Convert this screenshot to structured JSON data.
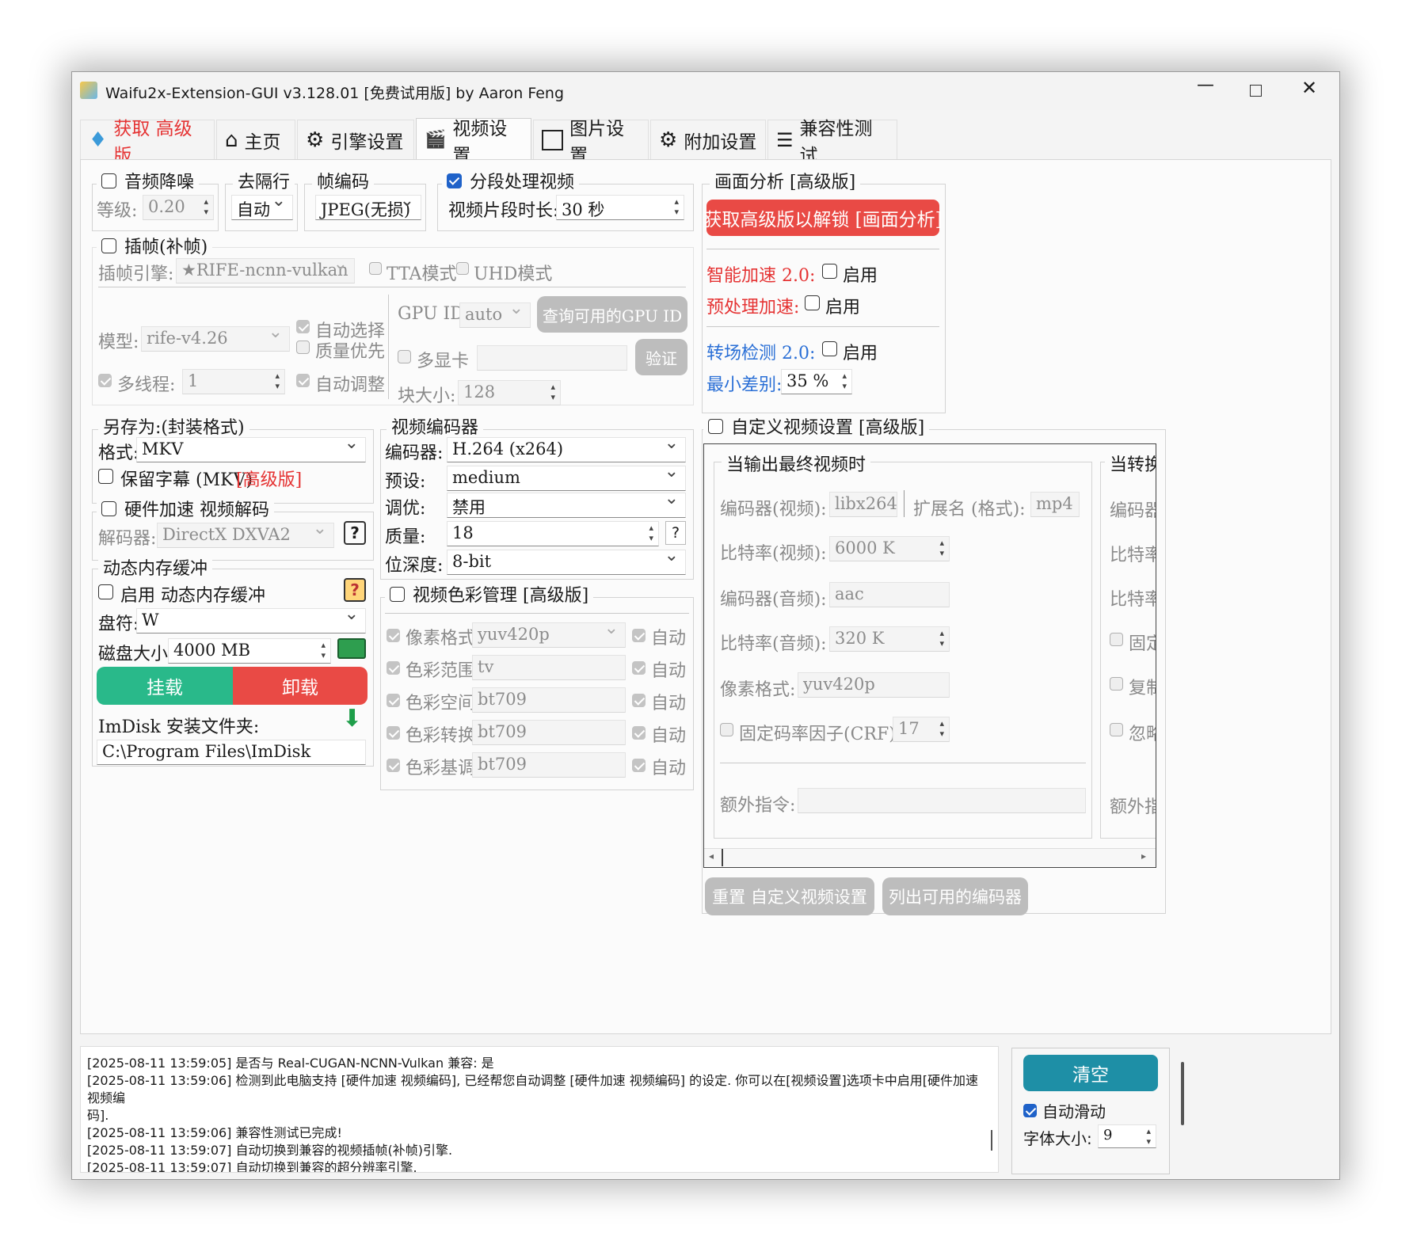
{
  "window": {
    "title": "Waifu2x-Extension-GUI v3.128.01 [免费试用版] by Aaron Feng"
  },
  "tabs": [
    "获取 高级版",
    "主页",
    "引擎设置",
    "视频设置",
    "图片设置",
    "附加设置",
    "兼容性测试"
  ],
  "audio": {
    "title": "音频降噪",
    "level_label": "等级:",
    "level": "0.20"
  },
  "deinterlace": {
    "title": "去隔行",
    "value": "自动"
  },
  "frame_codec": {
    "title": "帧编码",
    "value": "JPEG(无损)"
  },
  "segment": {
    "title": "分段处理视频",
    "duration_label": "视频片段时长:",
    "duration": "30 秒"
  },
  "analysis": {
    "title": "画面分析 [高级版]",
    "unlock_button": "获取高级版以解锁 [画面分析]",
    "smart_accel": "智能加速 2.0:",
    "preprocess_accel": "预处理加速:",
    "enable": "启用",
    "scene_detect": "转场检测 2.0:",
    "min_diff_label": "最小差别:",
    "min_diff": "35 %"
  },
  "interp": {
    "title": "插帧(补帧)",
    "engine_label": "插帧引擎:",
    "engine": "★RIFE-ncnn-vulkan",
    "tta": "TTA模式",
    "uhd": "UHD模式",
    "model_label": "模型:",
    "model": "rife-v4.26",
    "auto_select": "自动选择",
    "quality_first": "质量优先",
    "multithread_label": "多线程:",
    "multithread": "1",
    "auto_adjust": "自动调整",
    "gpu_label": "GPU ID:",
    "gpu": "auto",
    "query_gpu": "查询可用的GPU ID",
    "multi_gpu": "多显卡",
    "verify": "验证",
    "block_label": "块大小:",
    "block": "128"
  },
  "save_as": {
    "title": "另存为:(封装格式)",
    "format_label": "格式:",
    "format": "MKV",
    "keep_subs": "保留字幕 (MKV)",
    "keep_subs_pro": "[高级版]"
  },
  "hw_decode": {
    "title": "硬件加速 视频解码",
    "decoder_label": "解码器:",
    "decoder": "DirectX DXVA2",
    "help": "?"
  },
  "ramdisk": {
    "title": "动态内存缓冲",
    "enable_label": "启用 动态内存缓冲",
    "drive_label": "盘符:",
    "drive": "W",
    "size_label": "磁盘大小:",
    "size": "4000 MB",
    "mount": "挂载",
    "unmount": "卸载",
    "imdisk_label": "ImDisk 安装文件夹:",
    "imdisk_path": "C:\\Program Files\\ImDisk"
  },
  "encoder": {
    "title": "视频编码器",
    "codec_label": "编码器:",
    "codec": "H.264 (x264)",
    "preset_label": "预设:",
    "preset": "medium",
    "tune_label": "调优:",
    "tune": "禁用",
    "quality_label": "质量:",
    "quality": "18",
    "bitdepth_label": "位深度:",
    "bitdepth": "8-bit"
  },
  "color": {
    "title": "视频色彩管理 [高级版]",
    "rows": [
      {
        "label": "像素格式",
        "value": "yuv420p"
      },
      {
        "label": "色彩范围",
        "value": "tv"
      },
      {
        "label": "色彩空间",
        "value": "bt709"
      },
      {
        "label": "色彩转换",
        "value": "bt709"
      },
      {
        "label": "色彩基调",
        "value": "bt709"
      }
    ],
    "auto": "自动"
  },
  "custom": {
    "title": "自定义视频设置 [高级版]",
    "sub_title": "当输出最终视频时",
    "sub_title2": "当转换",
    "vcodec_label": "编码器(视频):",
    "vcodec": "libx264",
    "ext_label": "扩展名 (格式):",
    "ext": "mp4",
    "vbitrate_label": "比特率(视频):",
    "vbitrate": "6000 K",
    "acodec_label": "编码器(音频):",
    "acodec": "aac",
    "abitrate_label": "比特率(音频):",
    "abitrate": "320 K",
    "pixfmt_label": "像素格式:",
    "pixfmt": "yuv420p",
    "crf_label": "固定码率因子(CRF):",
    "crf": "17",
    "extra_label": "额外指令:",
    "right_labels": [
      "编码器",
      "比特率",
      "比特率",
      "固定",
      "复制",
      "忽略",
      "额外指"
    ],
    "reset": "重置 自定义视频设置",
    "list": "列出可用的编码器"
  },
  "log": {
    "lines": [
      "[2025-08-11 13:59:05] 是否与 Real-CUGAN-NCNN-Vulkan 兼容: 是",
      "[2025-08-11 13:59:06] 检测到此电脑支持 [硬件加速 视频编码], 已经帮您自动调整 [硬件加速 视频编码] 的设定. 你可以在[视频设置]选项卡中启用[硬件加速 视频编",
      "码].",
      "[2025-08-11 13:59:06] 兼容性测试已完成!",
      "[2025-08-11 13:59:07] 自动切换到兼容的视频插帧(补帧)引擎.",
      "[2025-08-11 13:59:07] 自动切换到兼容的超分辨率引擎."
    ],
    "clear": "清空",
    "autoscroll": "自动滑动",
    "font_size_label": "字体大小:",
    "font_size": "9"
  },
  "colors": {
    "red": "#e94a45",
    "teal": "#1e8fa6",
    "green": "#29b98a",
    "gray_btn": "#bdbdbd"
  }
}
